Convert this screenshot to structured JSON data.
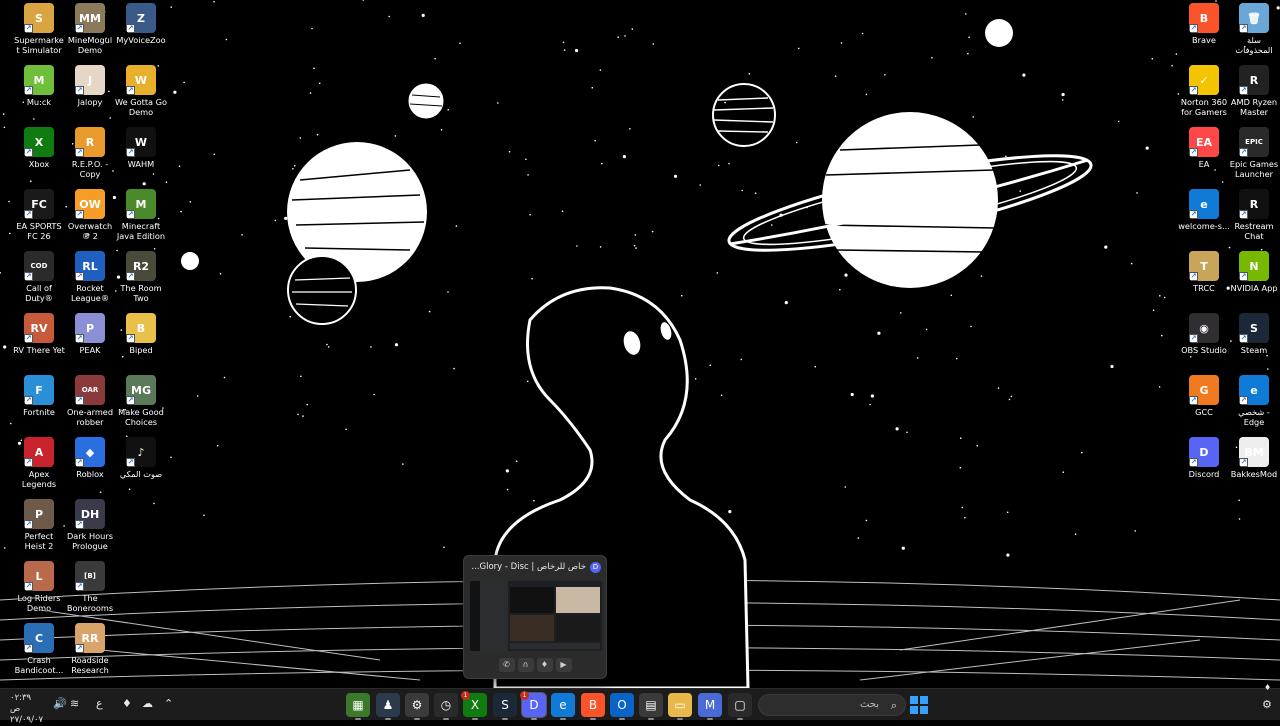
{
  "desktop": {
    "left_col_1": [
      {
        "label": "Supermarket Simulator ...",
        "icon": "supermarket-simulator-icon",
        "color": "#d9a441",
        "glyph": "S"
      },
      {
        "label": "Mu:ck",
        "icon": "muck-icon",
        "color": "#6fbf3a",
        "glyph": "M"
      },
      {
        "label": "Xbox",
        "icon": "xbox-icon",
        "color": "#107c10",
        "glyph": "X"
      },
      {
        "label": "EA SPORTS FC 26",
        "icon": "ea-sports-fc-icon",
        "color": "#1a1a1a",
        "glyph": "FC"
      },
      {
        "label": "Call of Duty®",
        "icon": "call-of-duty-icon",
        "color": "#2b2b2b",
        "glyph": "COD"
      },
      {
        "label": "RV There Yet",
        "icon": "rv-there-yet-icon",
        "color": "#c85a3c",
        "glyph": "RV"
      },
      {
        "label": "Fortnite",
        "icon": "fortnite-icon",
        "color": "#2a8fd6",
        "glyph": "F"
      },
      {
        "label": "Apex Legends",
        "icon": "apex-legends-icon",
        "color": "#c8232c",
        "glyph": "A"
      },
      {
        "label": "Perfect Heist 2",
        "icon": "perfect-heist-icon",
        "color": "#6e5a4a",
        "glyph": "P"
      },
      {
        "label": "Log Riders Demo",
        "icon": "log-riders-icon",
        "color": "#b96a4a",
        "glyph": "L"
      },
      {
        "label": "Crash Bandicoot...",
        "icon": "crash-bandicoot-icon",
        "color": "#2a6fb5",
        "glyph": "C"
      }
    ],
    "left_col_2": [
      {
        "label": "MineMogul Demo",
        "icon": "minemogul-icon",
        "color": "#8a7a5a",
        "glyph": "MM"
      },
      {
        "label": "Jalopy",
        "icon": "jalopy-icon",
        "color": "#e6d6c6",
        "glyph": "J"
      },
      {
        "label": "R.E.P.O. - Copy",
        "icon": "repo-icon",
        "color": "#e89a2a",
        "glyph": "R"
      },
      {
        "label": "Overwatch® 2",
        "icon": "overwatch-icon",
        "color": "#f59d26",
        "glyph": "OW"
      },
      {
        "label": "Rocket League®",
        "icon": "rocket-league-icon",
        "color": "#1f5fbf",
        "glyph": "RL"
      },
      {
        "label": "PEAK",
        "icon": "peak-icon",
        "color": "#8a8fd6",
        "glyph": "P"
      },
      {
        "label": "One-armed robber",
        "icon": "one-armed-robber-icon",
        "color": "#8a3a3a",
        "glyph": "OAR"
      },
      {
        "label": "Roblox",
        "icon": "roblox-icon",
        "color": "#2a6fe0",
        "glyph": "◆"
      },
      {
        "label": "Dark Hours Prologue",
        "icon": "dark-hours-icon",
        "color": "#3a3a4a",
        "glyph": "DH"
      },
      {
        "label": "The Bonerooms",
        "icon": "bonerooms-icon",
        "color": "#3a3a3a",
        "glyph": "[B]"
      },
      {
        "label": "Roadside Research",
        "icon": "roadside-research-icon",
        "color": "#d9a46a",
        "glyph": "RR"
      }
    ],
    "left_col_3": [
      {
        "label": "MyVoiceZoo",
        "icon": "myvoicezoo-icon",
        "color": "#3a5a8a",
        "glyph": "Z"
      },
      {
        "label": "We Gotta Go Demo",
        "icon": "we-gotta-go-icon",
        "color": "#e8b02a",
        "glyph": "W"
      },
      {
        "label": "WAHM",
        "icon": "wahm-icon",
        "color": "#111111",
        "glyph": "W"
      },
      {
        "label": "Minecraft Java Edition",
        "icon": "minecraft-icon",
        "color": "#4a8a2a",
        "glyph": "M"
      },
      {
        "label": "The Room Two",
        "icon": "the-room-two-icon",
        "color": "#4a4a3a",
        "glyph": "R2"
      },
      {
        "label": "Biped",
        "icon": "biped-icon",
        "color": "#e8c04a",
        "glyph": "B"
      },
      {
        "label": "Make Good Choices",
        "icon": "make-good-choices-icon",
        "color": "#5a7a5a",
        "glyph": "MG"
      },
      {
        "label": "صوت المكي",
        "icon": "audio-icon",
        "color": "#111111",
        "glyph": "♪"
      }
    ],
    "right_col_1": [
      {
        "label": "Brave",
        "icon": "brave-icon",
        "color": "#fb542b",
        "glyph": "B"
      },
      {
        "label": "Norton 360 for Gamers",
        "icon": "norton-icon",
        "color": "#f2c500",
        "glyph": "✓"
      },
      {
        "label": "EA",
        "icon": "ea-icon",
        "color": "#ff4747",
        "glyph": "EA"
      },
      {
        "label": "welcome-s...",
        "icon": "edge-icon",
        "color": "#0f7bd6",
        "glyph": "e"
      },
      {
        "label": "TRCC",
        "icon": "trcc-icon",
        "color": "#c9a55a",
        "glyph": "T"
      },
      {
        "label": "OBS Studio",
        "icon": "obs-icon",
        "color": "#302e31",
        "glyph": "◉"
      },
      {
        "label": "GCC",
        "icon": "gcc-icon",
        "color": "#f07a1f",
        "glyph": "G"
      },
      {
        "label": "Discord",
        "icon": "discord-icon",
        "color": "#5865f2",
        "glyph": "D"
      }
    ],
    "right_col_2": [
      {
        "label": "سلة المحذوفات",
        "icon": "recycle-bin-icon",
        "color": "#6aa6d6",
        "glyph": "🗑"
      },
      {
        "label": "AMD Ryzen Master",
        "icon": "amd-ryzen-icon",
        "color": "#222222",
        "glyph": "R"
      },
      {
        "label": "Epic Games Launcher",
        "icon": "epic-games-icon",
        "color": "#2a2a2a",
        "glyph": "EPIC"
      },
      {
        "label": "Restream Chat",
        "icon": "restream-icon",
        "color": "#111111",
        "glyph": "R"
      },
      {
        "label": "NVIDIA App",
        "icon": "nvidia-icon",
        "color": "#76b900",
        "glyph": "N"
      },
      {
        "label": "Steam",
        "icon": "steam-icon",
        "color": "#1b2838",
        "glyph": "S"
      },
      {
        "label": "شخصي - Edge",
        "icon": "edge-profile-icon",
        "color": "#0f7bd6",
        "glyph": "e"
      },
      {
        "label": "BakkesMod",
        "icon": "bakkesmod-icon",
        "color": "#eeeeee",
        "glyph": "BM"
      }
    ]
  },
  "preview": {
    "title": "خاص للرخاص | Glory - Disc...",
    "app_icon": "discord-icon",
    "controls": [
      "phone-icon",
      "headset-icon",
      "microphone-icon",
      "camera-icon"
    ]
  },
  "taskbar": {
    "search_placeholder": "بحث",
    "start_icon": "windows-start-icon",
    "apps": [
      {
        "name": "minecraft-launcher-icon",
        "color": "#3a7a2a",
        "glyph": "▦"
      },
      {
        "name": "app-figure-icon",
        "color": "#2b3a4a",
        "glyph": "♟"
      },
      {
        "name": "settings-icon",
        "color": "#3a3a3a",
        "glyph": "⚙"
      },
      {
        "name": "clock-app-icon",
        "color": "#2a2a2a",
        "glyph": "◷",
        "badge": ""
      },
      {
        "name": "xbox-taskbar-icon",
        "color": "#107c10",
        "glyph": "X",
        "badge": "1"
      },
      {
        "name": "steam-taskbar-icon",
        "color": "#1b2838",
        "glyph": "S"
      },
      {
        "name": "discord-taskbar-icon",
        "color": "#5865f2",
        "glyph": "D",
        "badge": "1",
        "active": true
      },
      {
        "name": "edge-taskbar-icon",
        "color": "#0f7bd6",
        "glyph": "e"
      },
      {
        "name": "brave-taskbar-icon",
        "color": "#fb542b",
        "glyph": "B"
      },
      {
        "name": "outlook-icon",
        "color": "#0a64c8",
        "glyph": "O"
      },
      {
        "name": "store-icon",
        "color": "#3a3a3a",
        "glyph": "▤"
      },
      {
        "name": "file-explorer-icon",
        "color": "#e8b84a",
        "glyph": "▭"
      },
      {
        "name": "m365-icon",
        "color": "#4a6ad6",
        "glyph": "M"
      },
      {
        "name": "task-view-icon",
        "color": "#2a2a2a",
        "glyph": "▢"
      }
    ],
    "tray": {
      "language": "ع",
      "time": "٠٢:٣٩ ص",
      "date": "٢٧/٠٩/٠٧"
    }
  }
}
